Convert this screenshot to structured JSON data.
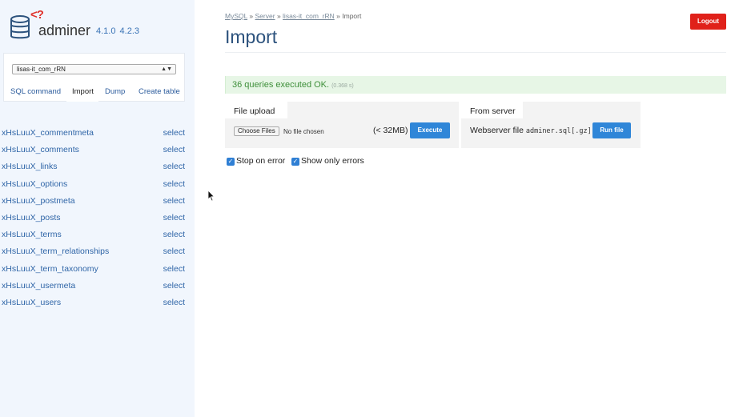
{
  "app": {
    "brand": "adminer",
    "version": "4.1.0",
    "version_new": "4.2.3"
  },
  "sidebar": {
    "database_selected": "lisas-it_com_rRN",
    "db_tabs": [
      {
        "label": "SQL command"
      },
      {
        "label": "Import"
      },
      {
        "label": "Dump"
      },
      {
        "label": "Create table"
      }
    ],
    "tables": [
      {
        "name": "xHsLuuX_commentmeta",
        "action": "select"
      },
      {
        "name": "xHsLuuX_comments",
        "action": "select"
      },
      {
        "name": "xHsLuuX_links",
        "action": "select"
      },
      {
        "name": "xHsLuuX_options",
        "action": "select"
      },
      {
        "name": "xHsLuuX_postmeta",
        "action": "select"
      },
      {
        "name": "xHsLuuX_posts",
        "action": "select"
      },
      {
        "name": "xHsLuuX_terms",
        "action": "select"
      },
      {
        "name": "xHsLuuX_term_relationships",
        "action": "select"
      },
      {
        "name": "xHsLuuX_term_taxonomy",
        "action": "select"
      },
      {
        "name": "xHsLuuX_usermeta",
        "action": "select"
      },
      {
        "name": "xHsLuuX_users",
        "action": "select"
      }
    ]
  },
  "breadcrumb": {
    "items": [
      "MySQL",
      "Server",
      "lisas-it_com_rRN"
    ],
    "sep": "»",
    "current": "Import"
  },
  "header": {
    "title": "Import",
    "logout_label": "Logout"
  },
  "message": {
    "text": "36 queries executed OK.",
    "time": "(0.368 s)"
  },
  "file_upload": {
    "legend": "File upload",
    "choose_label": "Choose Files",
    "no_file": "No file chosen",
    "limit": "(< 32MB)",
    "execute_label": "Execute"
  },
  "from_server": {
    "legend": "From server",
    "label": "Webserver file",
    "file": "adminer.sql[.gz]",
    "run_label": "Run file"
  },
  "options": {
    "stop_on_error": "Stop on error",
    "show_only_errors": "Show only errors"
  },
  "colors": {
    "link": "#2f65a7",
    "logout": "#e0211a",
    "button": "#2f86d8",
    "success_bg": "#e7f6e6",
    "success_text": "#3e8f3a",
    "sidebar_bg": "#f1f6fd"
  }
}
